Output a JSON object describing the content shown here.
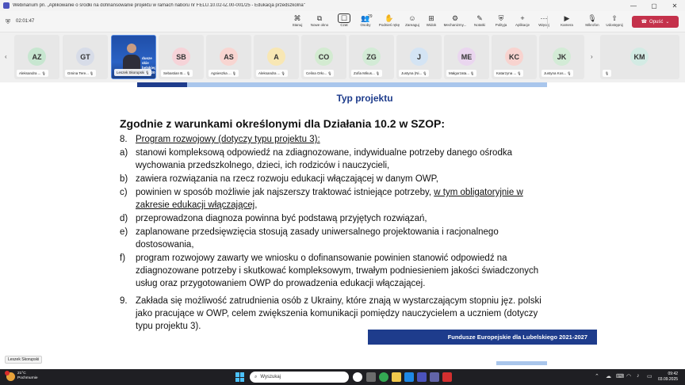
{
  "window": {
    "title": "Webinarium pn. „Aplikowanie o środki na dofinansowanie projektu w ramach naboru nr FELU.10.02-IZ.00-001/25 - Edukacja przedszkolna\"",
    "minimize": "—",
    "maximize": "▢",
    "close": "✕"
  },
  "meeting": {
    "timer": "02:01:47",
    "tools": [
      {
        "label": "Stanuj",
        "icon": "pin-icon",
        "glyph": "⌘"
      },
      {
        "label": "Nowe okno",
        "icon": "new-window-icon",
        "glyph": "⧉"
      },
      {
        "label": "Czat",
        "icon": "chat-icon",
        "glyph": "☐"
      },
      {
        "label": "Osoby",
        "icon": "people-icon",
        "glyph": "👥",
        "count": "29"
      },
      {
        "label": "Podnieś rękę",
        "icon": "raise-hand-icon",
        "glyph": "✋"
      },
      {
        "label": "Zareaguj",
        "icon": "react-icon",
        "glyph": "☺"
      },
      {
        "label": "Widok",
        "icon": "view-icon",
        "glyph": "⊞"
      },
      {
        "label": "Mechanizmy...",
        "icon": "apps-icon",
        "glyph": "⚙"
      },
      {
        "label": "Notatki",
        "icon": "notes-icon",
        "glyph": "✎"
      },
      {
        "label": "Polityja",
        "icon": "policy-icon",
        "glyph": "⛨"
      },
      {
        "label": "Aplikacje",
        "icon": "add-apps-icon",
        "glyph": "+"
      },
      {
        "label": "Więcej",
        "icon": "more-icon",
        "glyph": "⋯"
      },
      {
        "label": "Kamera",
        "icon": "camera-icon",
        "glyph": "▶"
      },
      {
        "label": "Mikrofon",
        "icon": "microphone-icon",
        "glyph": "🎙"
      },
      {
        "label": "Udostępnij",
        "icon": "share-icon",
        "glyph": "⇧"
      }
    ],
    "leave_label": "Opuść",
    "leave_icon": "phone-icon"
  },
  "participants": [
    {
      "initials": "AZ",
      "name": "Aleksandra ...",
      "color": "#c7e6d0"
    },
    {
      "initials": "GT",
      "name": "Gmina Tere...",
      "color": "#d7dce8"
    },
    {
      "initials": "",
      "name": "Leszek Skorupski",
      "video": true,
      "video_text": "dusze\nskie\nbelskiego\n2021-20"
    },
    {
      "initials": "SB",
      "name": "Sebastian B...",
      "color": "#f6d3d8"
    },
    {
      "initials": "AS",
      "name": "Agnieszka ...",
      "color": "#f8d5d1"
    },
    {
      "initials": "A",
      "name": "Aleksandra ...",
      "color": "#f8e7b4"
    },
    {
      "initials": "CO",
      "name": "Celina Orło...",
      "color": "#d3ebd1"
    },
    {
      "initials": "ZG",
      "name": "Zofia Mikus...",
      "color": "#d3ebd6"
    },
    {
      "initials": "J",
      "name": "Justyna (Ni...",
      "color": "#d4e4f4"
    },
    {
      "initials": "ME",
      "name": "Małgorzata...",
      "color": "#ead6ef"
    },
    {
      "initials": "KC",
      "name": "Katarzyna ...",
      "color": "#f8d3cf"
    },
    {
      "initials": "JK",
      "name": "Justyna Kos...",
      "color": "#d3ebd6"
    },
    {
      "initials": "KM",
      "name": "",
      "color": "#d3ebe4"
    }
  ],
  "slide": {
    "title": "Typ projektu",
    "heading": "Zgodnie z warunkami określonymi dla Działania 10.2 w SZOP:",
    "item8_num": "8.",
    "item8": "Program rozwojowy (dotyczy typu projektu 3):",
    "a_lbl": "a)",
    "a1": "stanowi kompleksową odpowiedź na zdiagnozowane, indywidualne potrzeby danego ośrodka",
    "a2": "wychowania przedszkolnego, dzieci, ich rodziców i nauczycieli,",
    "b_lbl": "b)",
    "b1": "zawiera rozwiązania na rzecz rozwoju edukacji włączającej w danym OWP,",
    "c_lbl": "c)",
    "c1_pre": "powinien w sposób możliwie jak najszerszy traktować istniejące potrzeby, ",
    "c1_ul": "w tym obligatoryjnie w",
    "c2": "zakresie edukacji włączającej",
    "c2_end": ",",
    "d_lbl": "d)",
    "d1": "przeprowadzona diagnoza powinna być podstawą przyjętych rozwiązań,",
    "e_lbl": "e)",
    "e1": "zaplanowane przedsięwzięcia stosują zasady uniwersalnego projektowania i racjonalnego",
    "e2": "dostosowania,",
    "f_lbl": "f)",
    "f1": "program rozwojowy zawarty we wniosku o dofinansowanie powinien stanowić odpowiedź na",
    "f2": "zdiagnozowane potrzeby i skutkować kompleksowym, trwałym podniesieniem jakości świadczonych",
    "f3": "usług oraz przygotowaniem OWP do prowadzenia edukacji włączającej.",
    "item9_num": "9.",
    "n9_1": "Zakłada się możliwość zatrudnienia osób z Ukrainy, które znają w wystarczającym stopniu jęz. polski",
    "n9_2": "jako pracujące w OWP, celem zwiększenia komunikacji pomiędzy nauczycielem a uczniem (dotyczy",
    "n9_3": "typu projektu 3).",
    "footer": "Fundusze Europejskie dla Lubelskiego 2021-2027",
    "accent_color": "#1e3c8c",
    "light_accent": "#a9c6ec"
  },
  "presenter_label": "Leszek Skorupski",
  "taskbar": {
    "weather_temp": "21°C",
    "weather_desc": "Pochmurnie",
    "weather_badge": "1",
    "search_placeholder": "Wyszukaj",
    "time": "09:42",
    "date": "03.09.2025"
  }
}
